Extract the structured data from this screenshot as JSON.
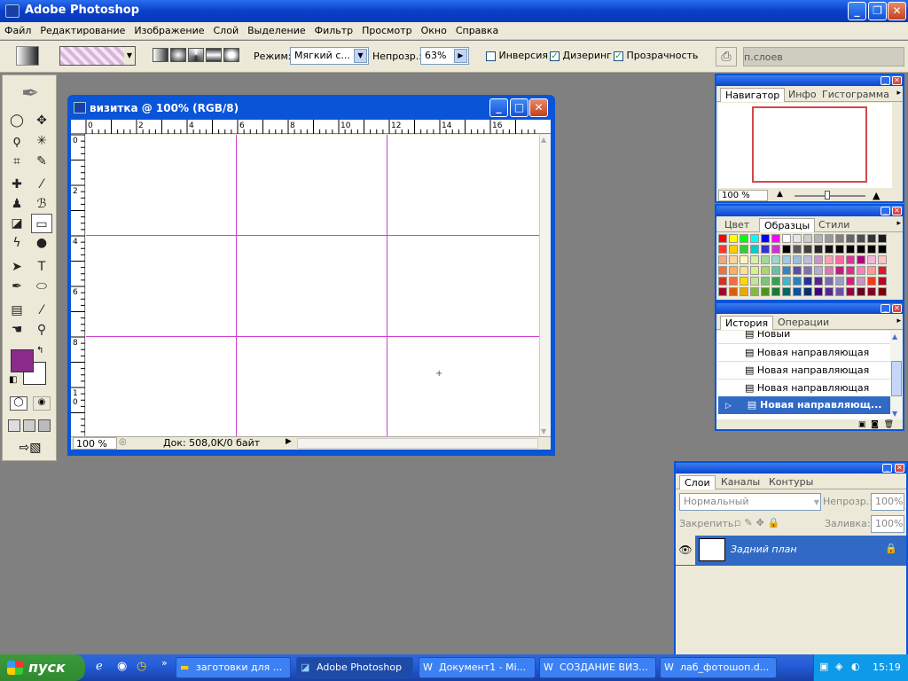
{
  "app": {
    "title": "Adobe Photoshop"
  },
  "titlebar": {
    "minimize": "_",
    "restore": "❐",
    "close": "✕"
  },
  "menu": [
    "Файл",
    "Редактирование",
    "Изображение",
    "Слой",
    "Выделение",
    "Фильтр",
    "Просмотр",
    "Окно",
    "Справка"
  ],
  "options": {
    "mode_label": "Режим:",
    "mode_value": "Мягкий с...",
    "opacity_label": "Непрозр.:",
    "opacity_value": "63%",
    "inverse_label": "Инверсия",
    "inverse_checked": false,
    "dither_label": "Дизеринг",
    "dither_checked": true,
    "transparency_label": "Прозрачность",
    "transparency_checked": true,
    "layers_tab": "п.слоев"
  },
  "document": {
    "title": "визитка @ 100% (RGB/8)",
    "zoom": "100 %",
    "status": "Док: 508,0K/0 байт",
    "ruler_top": [
      "0",
      "2",
      "4",
      "6",
      "8",
      "10",
      "12",
      "14",
      "16"
    ],
    "ruler_left": [
      "0",
      "2",
      "4",
      "6",
      "8",
      "1\n0"
    ]
  },
  "navigator": {
    "tabs": [
      "Навигатор",
      "Инфо",
      "Гистограмма"
    ],
    "zoom": "100 %"
  },
  "swatches": {
    "tabs": [
      "Цвет",
      "Образцы",
      "Стили"
    ],
    "rows": [
      [
        "#ff0000",
        "#ffff00",
        "#00ff00",
        "#00ffff",
        "#0000ff",
        "#ff00ff",
        "#ffffff",
        "#e6e6e6",
        "#cccccc",
        "#b3b3b3",
        "#999999",
        "#808080",
        "#666666",
        "#4d4d4d",
        "#333333",
        "#1a1a1a"
      ],
      [
        "#ff3333",
        "#ffcc00",
        "#33cc33",
        "#00cccc",
        "#3333cc",
        "#cc33cc",
        "#000000",
        "#595959",
        "#404040",
        "#262626",
        "#0d0d0d",
        "#000000",
        "#000000",
        "#000000",
        "#000000",
        "#000000"
      ],
      [
        "#f4a582",
        "#fdd49e",
        "#fff7bc",
        "#d9f0a3",
        "#a1d99b",
        "#99d8c9",
        "#9ecae1",
        "#9ebcda",
        "#bcbddc",
        "#c994c7",
        "#fa9fb5",
        "#f768a1",
        "#dd3497",
        "#ae017e",
        "#f1b6da",
        "#fcc5c0"
      ],
      [
        "#f46d43",
        "#fdae61",
        "#fee08b",
        "#d9ef8b",
        "#a6d96a",
        "#66c2a5",
        "#3288bd",
        "#5e4fa2",
        "#8073ac",
        "#b2abd2",
        "#de77ae",
        "#c51b7d",
        "#e7298a",
        "#f781bf",
        "#fb9a99",
        "#e31a1c"
      ],
      [
        "#d73027",
        "#f46d43",
        "#ffd700",
        "#c2e699",
        "#78c679",
        "#31a354",
        "#41b6c4",
        "#2c7fb8",
        "#253494",
        "#54278f",
        "#756bb1",
        "#9e9ac8",
        "#dd1c77",
        "#c994c7",
        "#f03b20",
        "#bd0026"
      ],
      [
        "#a50026",
        "#d95f0e",
        "#e6ab02",
        "#7fbc41",
        "#4d9221",
        "#1b7837",
        "#01665e",
        "#08519c",
        "#08306b",
        "#3f007d",
        "#54278f",
        "#6a51a3",
        "#980043",
        "#67001f",
        "#800026",
        "#7f0000"
      ]
    ]
  },
  "history": {
    "tabs": [
      "История",
      "Операции"
    ],
    "items": [
      "Новый",
      "Новая направляющая",
      "Новая направляющая",
      "Новая направляющая",
      "Новая направляющ..."
    ]
  },
  "layers": {
    "tabs": [
      "Слои",
      "Каналы",
      "Контуры"
    ],
    "blend_mode": "Нормальный",
    "opacity_label": "Непрозр.:",
    "opacity_value": "100%",
    "lock_label": "Закрепить:",
    "fill_label": "Заливка:",
    "fill_value": "100%",
    "layer_name": "Задний план"
  },
  "colors": {
    "foreground": "#8b2a8b",
    "background": "#ffffff",
    "guide": "#d040d0"
  },
  "taskbar": {
    "start": "пуск",
    "items": [
      "заготовки для ...",
      "Adobe Photoshop",
      "Документ1 - Mi...",
      "СОЗДАНИЕ ВИЗ...",
      "лаб_фотошоп.d..."
    ],
    "chevron": "»",
    "clock": "15:19"
  }
}
